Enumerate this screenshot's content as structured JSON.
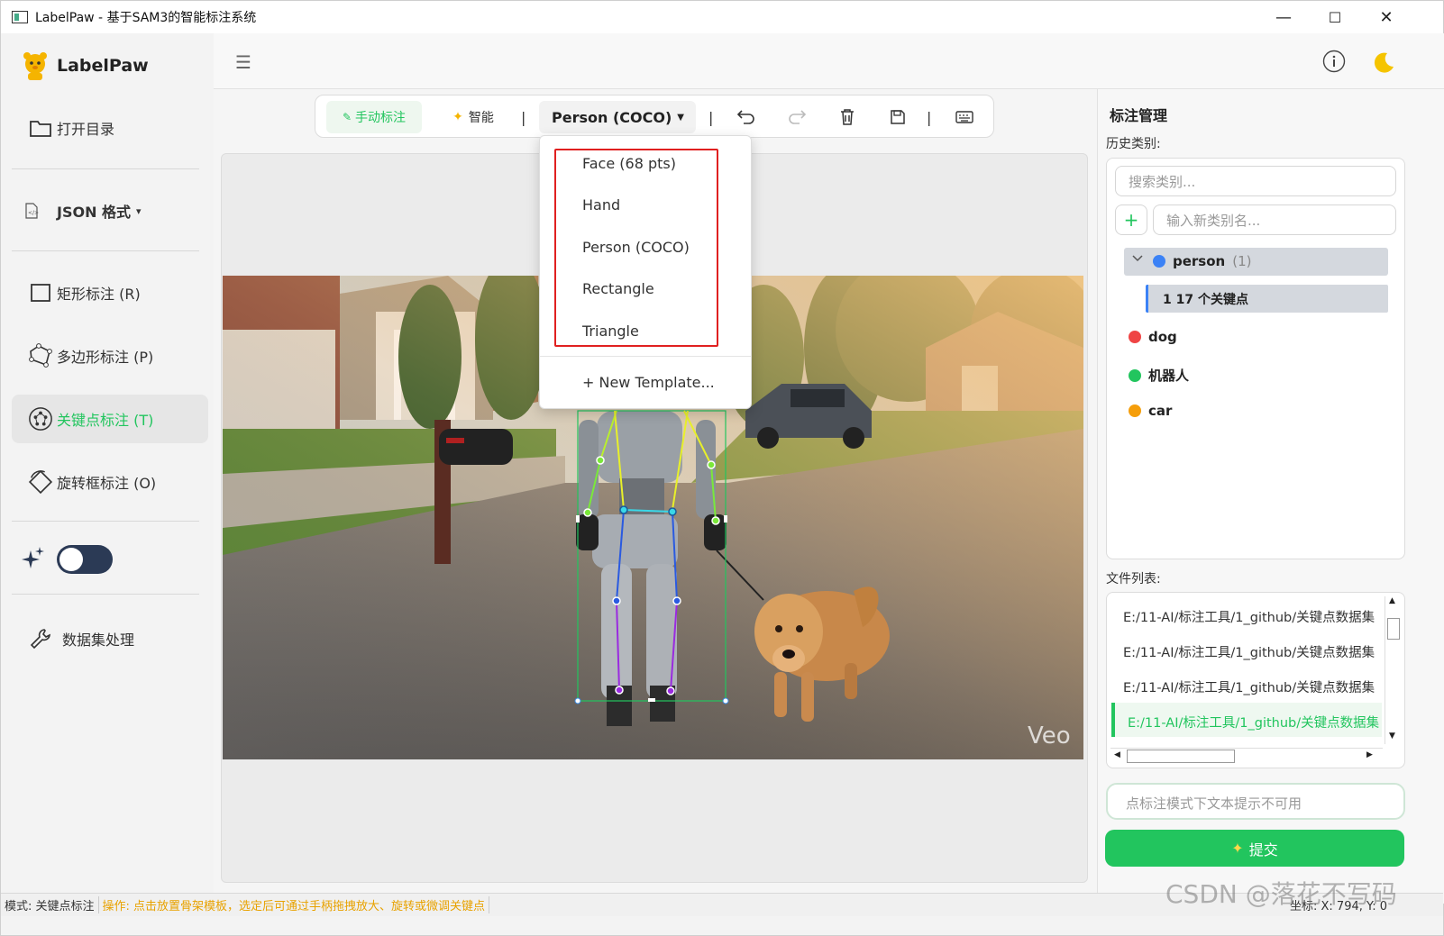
{
  "window": {
    "title": "LabelPaw - 基于SAM3的智能标注系统",
    "minimize": "—",
    "maximize": "☐",
    "close": "✕"
  },
  "brand": {
    "name": "LabelPaw"
  },
  "sidebar": {
    "open_dir": "打开目录",
    "format": "JSON 格式",
    "items": [
      {
        "label": "矩形标注 (R)",
        "icon": "rectangle-icon"
      },
      {
        "label": "多边形标注 (P)",
        "icon": "polygon-icon"
      },
      {
        "label": "关键点标注 (T)",
        "icon": "keypoint-icon",
        "active": true
      },
      {
        "label": "旋转框标注 (O)",
        "icon": "rotated-box-icon"
      }
    ],
    "ai_toggle": "off",
    "dataset": "数据集处理"
  },
  "toolbar": {
    "manual": "手动标注",
    "smart": "智能",
    "template": "Person (COCO)",
    "divider": "|"
  },
  "dropdown": {
    "items": [
      "Face (68 pts)",
      "Hand",
      "Person (COCO)",
      "Rectangle",
      "Triangle"
    ],
    "new_template": "+ New Template..."
  },
  "canvas": {
    "watermark": "Veo"
  },
  "right": {
    "title": "标注管理",
    "history_label": "历史类别:",
    "search_placeholder": "搜索类别...",
    "new_placeholder": "输入新类别名...",
    "add": "+",
    "categories": [
      {
        "name": "person",
        "count": "(1)",
        "color": "#3b82f6"
      },
      {
        "name": "dog",
        "color": "#ef4444"
      },
      {
        "name": "机器人",
        "color": "#22c55e"
      },
      {
        "name": "car",
        "color": "#f59e0b"
      }
    ],
    "person_child": "1 17 个关键点",
    "files_label": "文件列表:",
    "files": [
      "E:/11-AI/标注工具/1_github/关键点数据集",
      "E:/11-AI/标注工具/1_github/关键点数据集",
      "E:/11-AI/标注工具/1_github/关键点数据集",
      "E:/11-AI/标注工具/1_github/关键点数据集"
    ],
    "text_prompt": "点标注模式下文本提示不可用",
    "submit": "提交"
  },
  "status": {
    "mode": "模式: 关键点标注",
    "hint": "操作: 点击放置骨架模板，选定后可通过手柄拖拽放大、旋转或微调关键点",
    "coords": "坐标: X: 794, Y: 0"
  },
  "csdn_watermark": "CSDN @落花不写码",
  "colors": {
    "accent": "#22c55e",
    "hint": "#e8a200",
    "dropdown_highlight": "#e02020"
  }
}
